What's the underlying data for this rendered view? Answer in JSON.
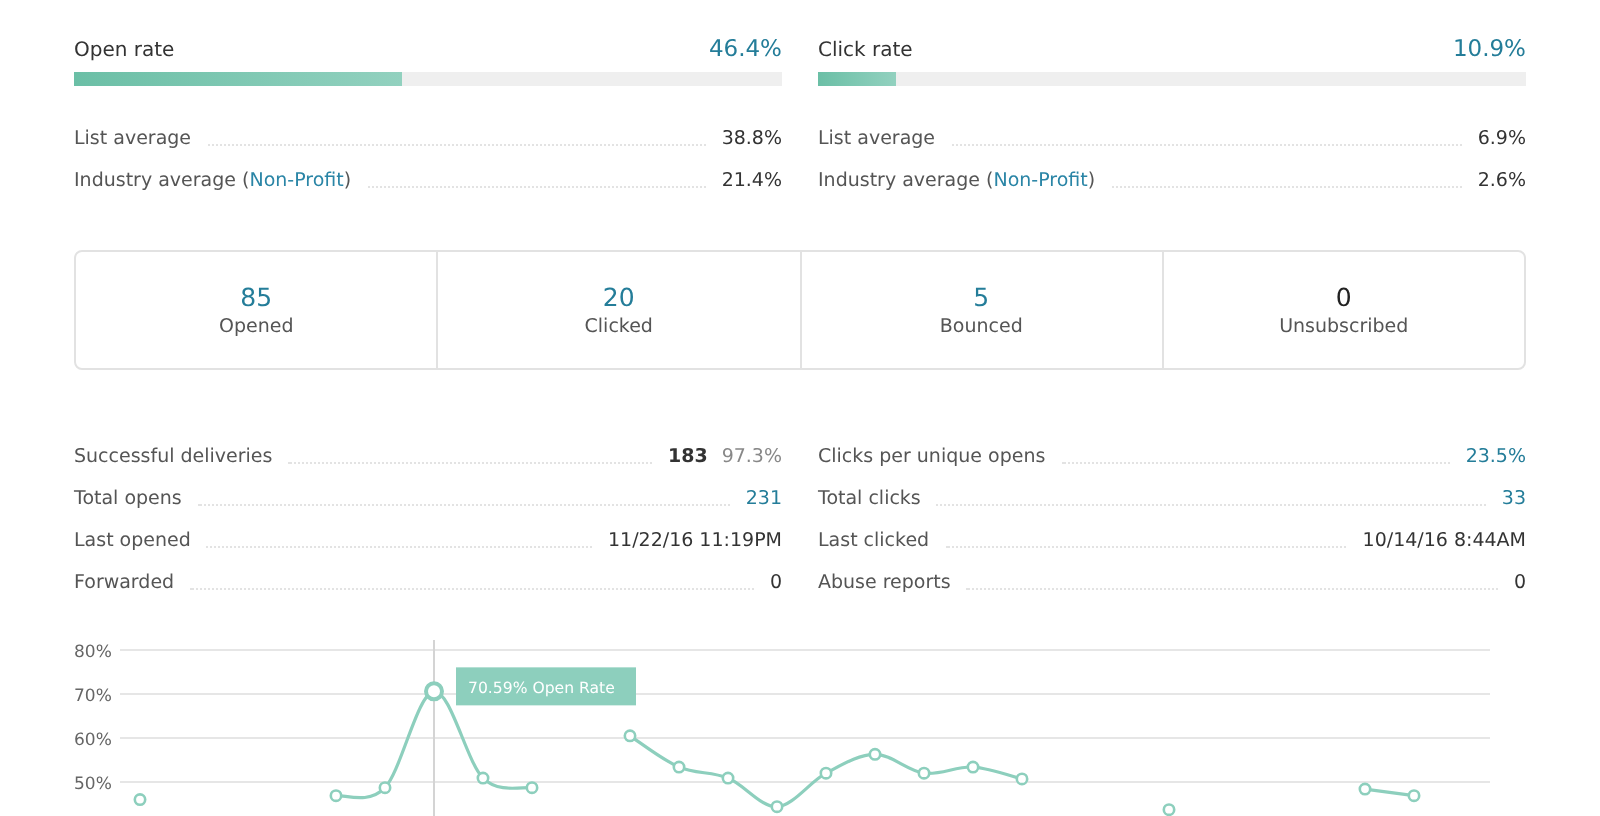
{
  "rates": [
    {
      "title": "Open rate",
      "value": "46.4%",
      "level": 0.464,
      "rows": [
        {
          "label": "List average",
          "value": "38.8%"
        },
        {
          "label": "Industry average (",
          "link": "Non-Profit",
          "after": ")",
          "value": "21.4%"
        }
      ]
    },
    {
      "title": "Click rate",
      "value": "10.9%",
      "level": 0.109,
      "rows": [
        {
          "label": "List average",
          "value": "6.9%"
        },
        {
          "label": "Industry average (",
          "link": "Non-Profit",
          "after": ")",
          "value": "2.6%"
        }
      ]
    }
  ],
  "stats": [
    {
      "number": "85",
      "label": "Opened",
      "link": true
    },
    {
      "number": "20",
      "label": "Clicked",
      "link": true
    },
    {
      "number": "5",
      "label": "Bounced",
      "link": true
    },
    {
      "number": "0",
      "label": "Unsubscribed",
      "link": false
    }
  ],
  "details": [
    [
      {
        "label": "Successful deliveries",
        "value": "183",
        "secondary": "97.3%",
        "link": false,
        "bold": true
      },
      {
        "label": "Total opens",
        "value": "231",
        "link": true,
        "bold": false
      },
      {
        "label": "Last opened",
        "value": "11/22/16 11:19PM",
        "link": false,
        "bold": false
      },
      {
        "label": "Forwarded",
        "value": "0",
        "link": false,
        "bold": false
      }
    ],
    [
      {
        "label": "Clicks per unique opens",
        "value": "23.5%",
        "link": true,
        "bold": false
      },
      {
        "label": "Total clicks",
        "value": "33",
        "link": true,
        "bold": false
      },
      {
        "label": "Last clicked",
        "value": "10/14/16 8:44AM",
        "link": false,
        "bold": false
      },
      {
        "label": "Abuse reports",
        "value": "0",
        "link": false,
        "bold": false
      }
    ]
  ],
  "chart_data": {
    "type": "line",
    "ylim": [
      40,
      80
    ],
    "yticks": [
      {
        "value": 80,
        "label": "80%"
      },
      {
        "value": 70,
        "label": "70%"
      },
      {
        "value": 60,
        "label": "60%"
      },
      {
        "value": 50,
        "label": "50%"
      }
    ],
    "grid": true,
    "series": [
      {
        "name": "Open Rate",
        "color": "#8dcfbd",
        "marker": "o",
        "values": [
          46,
          null,
          null,
          null,
          46.9,
          48.7,
          70.6,
          50.9,
          48.7,
          null,
          60.5,
          53.4,
          50.9,
          44.4,
          52,
          56.3,
          52,
          53.4,
          50.7,
          null,
          null,
          43.7,
          null,
          null,
          null,
          48.4,
          46.9,
          null
        ]
      }
    ],
    "annotations": [
      {
        "text": "70.59%"
      }
    ]
  }
}
